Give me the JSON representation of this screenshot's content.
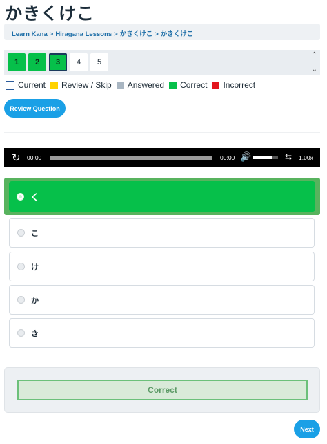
{
  "page_title": "かきくけこ",
  "breadcrumb": [
    "Learn Kana",
    "Hiragana Lessons",
    "かきくけこ",
    "かきくけこ"
  ],
  "breadcrumb_sep": ">",
  "question_nav": [
    {
      "label": "1",
      "state": "answered"
    },
    {
      "label": "2",
      "state": "answered"
    },
    {
      "label": "3",
      "state": "current-answered"
    },
    {
      "label": "4",
      "state": "unanswered"
    },
    {
      "label": "5",
      "state": "unanswered"
    }
  ],
  "legend": {
    "current": "Current",
    "review": "Review / Skip",
    "answered": "Answered",
    "correct": "Correct",
    "incorrect": "Incorrect"
  },
  "colors": {
    "accent": "#1aa0e6",
    "correct": "#06c04a",
    "incorrect": "#e3161e",
    "review": "#ffd200",
    "answered": "#a9b6c2"
  },
  "review_button": "Review Question",
  "audio_player": {
    "current_time": "00:00",
    "duration": "00:00",
    "speed": "1.00x",
    "volume_level": 0.75,
    "icons": [
      "replay-icon",
      "volume-icon",
      "loop-icon"
    ]
  },
  "answers": [
    {
      "label": "く",
      "selected": true
    },
    {
      "label": "こ",
      "selected": false
    },
    {
      "label": "け",
      "selected": false
    },
    {
      "label": "か",
      "selected": false
    },
    {
      "label": "き",
      "selected": false
    }
  ],
  "result_text": "Correct",
  "next_button": "Next"
}
